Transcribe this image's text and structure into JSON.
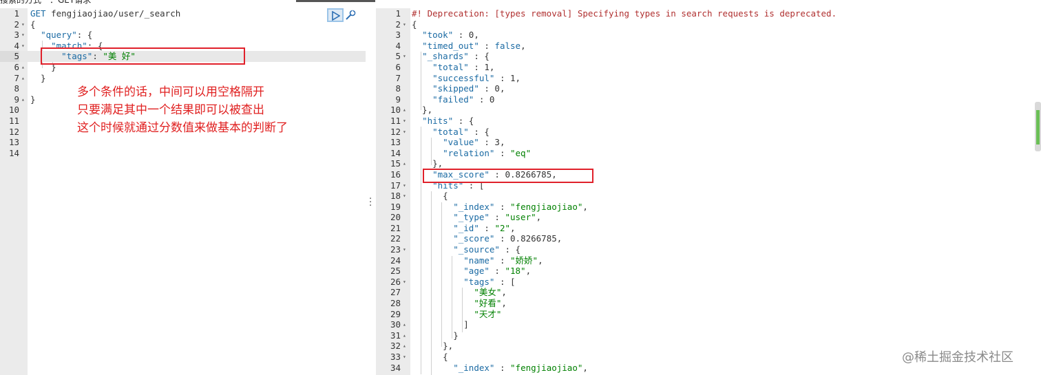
{
  "top_strip_text": "搜索的方式一：GET请求",
  "request_pane": {
    "lines": [
      {
        "n": "1",
        "fold": "",
        "html": [
          [
            "k",
            "GET "
          ],
          [
            "p",
            "fengjiaojiao/user/_search"
          ]
        ]
      },
      {
        "n": "2",
        "fold": "▾",
        "html": [
          [
            "p",
            "{"
          ]
        ]
      },
      {
        "n": "3",
        "fold": "▾",
        "html": [
          [
            "p",
            "  "
          ],
          [
            "n",
            "\"query\""
          ],
          [
            "p",
            ": {"
          ]
        ]
      },
      {
        "n": "4",
        "fold": "▾",
        "html": [
          [
            "p",
            "    "
          ],
          [
            "n",
            "\"match\""
          ],
          [
            "p",
            ": {"
          ]
        ]
      },
      {
        "n": "5",
        "fold": "",
        "html": [
          [
            "p",
            "      "
          ],
          [
            "n",
            "\"tags\""
          ],
          [
            "p",
            ": "
          ],
          [
            "s",
            "\"美 好\""
          ]
        ],
        "active": true
      },
      {
        "n": "6",
        "fold": "▴",
        "html": [
          [
            "p",
            "    }"
          ]
        ]
      },
      {
        "n": "7",
        "fold": "▴",
        "html": [
          [
            "p",
            "  }"
          ]
        ]
      },
      {
        "n": "8",
        "fold": "",
        "html": []
      },
      {
        "n": "9",
        "fold": "▴",
        "html": [
          [
            "p",
            "}"
          ]
        ]
      },
      {
        "n": "10",
        "fold": "",
        "html": []
      },
      {
        "n": "11",
        "fold": "",
        "html": []
      },
      {
        "n": "12",
        "fold": "",
        "html": []
      },
      {
        "n": "13",
        "fold": "",
        "html": []
      },
      {
        "n": "14",
        "fold": "",
        "html": []
      }
    ]
  },
  "response_pane": {
    "lines": [
      {
        "n": "1",
        "fold": "",
        "html": [
          [
            "cmt",
            "#! Deprecation: [types removal] Specifying types in search requests is deprecated."
          ]
        ]
      },
      {
        "n": "2",
        "fold": "▾",
        "html": [
          [
            "p",
            "{"
          ]
        ]
      },
      {
        "n": "3",
        "fold": "",
        "html": [
          [
            "p",
            "  "
          ],
          [
            "n",
            "\"took\""
          ],
          [
            "p",
            " : "
          ],
          [
            "m",
            "0"
          ],
          [
            "p",
            ","
          ]
        ]
      },
      {
        "n": "4",
        "fold": "",
        "html": [
          [
            "p",
            "  "
          ],
          [
            "n",
            "\"timed_out\""
          ],
          [
            "p",
            " : "
          ],
          [
            "k",
            "false"
          ],
          [
            "p",
            ","
          ]
        ]
      },
      {
        "n": "5",
        "fold": "▾",
        "html": [
          [
            "p",
            "  "
          ],
          [
            "n",
            "\"_shards\""
          ],
          [
            "p",
            " : {"
          ]
        ]
      },
      {
        "n": "6",
        "fold": "",
        "html": [
          [
            "p",
            "    "
          ],
          [
            "n",
            "\"total\""
          ],
          [
            "p",
            " : "
          ],
          [
            "m",
            "1"
          ],
          [
            "p",
            ","
          ]
        ]
      },
      {
        "n": "7",
        "fold": "",
        "html": [
          [
            "p",
            "    "
          ],
          [
            "n",
            "\"successful\""
          ],
          [
            "p",
            " : "
          ],
          [
            "m",
            "1"
          ],
          [
            "p",
            ","
          ]
        ]
      },
      {
        "n": "8",
        "fold": "",
        "html": [
          [
            "p",
            "    "
          ],
          [
            "n",
            "\"skipped\""
          ],
          [
            "p",
            " : "
          ],
          [
            "m",
            "0"
          ],
          [
            "p",
            ","
          ]
        ]
      },
      {
        "n": "9",
        "fold": "",
        "html": [
          [
            "p",
            "    "
          ],
          [
            "n",
            "\"failed\""
          ],
          [
            "p",
            " : "
          ],
          [
            "m",
            "0"
          ]
        ]
      },
      {
        "n": "10",
        "fold": "▴",
        "html": [
          [
            "p",
            "  },"
          ]
        ]
      },
      {
        "n": "11",
        "fold": "▾",
        "html": [
          [
            "p",
            "  "
          ],
          [
            "n",
            "\"hits\""
          ],
          [
            "p",
            " : {"
          ]
        ]
      },
      {
        "n": "12",
        "fold": "▾",
        "html": [
          [
            "p",
            "    "
          ],
          [
            "n",
            "\"total\""
          ],
          [
            "p",
            " : {"
          ]
        ]
      },
      {
        "n": "13",
        "fold": "",
        "html": [
          [
            "p",
            "      "
          ],
          [
            "n",
            "\"value\""
          ],
          [
            "p",
            " : "
          ],
          [
            "m",
            "3"
          ],
          [
            "p",
            ","
          ]
        ]
      },
      {
        "n": "14",
        "fold": "",
        "html": [
          [
            "p",
            "      "
          ],
          [
            "n",
            "\"relation\""
          ],
          [
            "p",
            " : "
          ],
          [
            "s",
            "\"eq\""
          ]
        ]
      },
      {
        "n": "15",
        "fold": "▴",
        "html": [
          [
            "p",
            "    },"
          ]
        ]
      },
      {
        "n": "16",
        "fold": "",
        "html": [
          [
            "p",
            "    "
          ],
          [
            "n",
            "\"max_score\""
          ],
          [
            "p",
            " : "
          ],
          [
            "m",
            "0.8266785"
          ],
          [
            "p",
            ","
          ]
        ]
      },
      {
        "n": "17",
        "fold": "▾",
        "html": [
          [
            "p",
            "    "
          ],
          [
            "n",
            "\"hits\""
          ],
          [
            "p",
            " : ["
          ]
        ]
      },
      {
        "n": "18",
        "fold": "▾",
        "html": [
          [
            "p",
            "      {"
          ]
        ]
      },
      {
        "n": "19",
        "fold": "",
        "html": [
          [
            "p",
            "        "
          ],
          [
            "n",
            "\"_index\""
          ],
          [
            "p",
            " : "
          ],
          [
            "s",
            "\"fengjiaojiao\""
          ],
          [
            "p",
            ","
          ]
        ]
      },
      {
        "n": "20",
        "fold": "",
        "html": [
          [
            "p",
            "        "
          ],
          [
            "n",
            "\"_type\""
          ],
          [
            "p",
            " : "
          ],
          [
            "s",
            "\"user\""
          ],
          [
            "p",
            ","
          ]
        ]
      },
      {
        "n": "21",
        "fold": "",
        "html": [
          [
            "p",
            "        "
          ],
          [
            "n",
            "\"_id\""
          ],
          [
            "p",
            " : "
          ],
          [
            "s",
            "\"2\""
          ],
          [
            "p",
            ","
          ]
        ]
      },
      {
        "n": "22",
        "fold": "",
        "html": [
          [
            "p",
            "        "
          ],
          [
            "n",
            "\"_score\""
          ],
          [
            "p",
            " : "
          ],
          [
            "m",
            "0.8266785"
          ],
          [
            "p",
            ","
          ]
        ]
      },
      {
        "n": "23",
        "fold": "▾",
        "html": [
          [
            "p",
            "        "
          ],
          [
            "n",
            "\"_source\""
          ],
          [
            "p",
            " : {"
          ]
        ]
      },
      {
        "n": "24",
        "fold": "",
        "html": [
          [
            "p",
            "          "
          ],
          [
            "n",
            "\"name\""
          ],
          [
            "p",
            " : "
          ],
          [
            "s",
            "\"娇娇\""
          ],
          [
            "p",
            ","
          ]
        ]
      },
      {
        "n": "25",
        "fold": "",
        "html": [
          [
            "p",
            "          "
          ],
          [
            "n",
            "\"age\""
          ],
          [
            "p",
            " : "
          ],
          [
            "s",
            "\"18\""
          ],
          [
            "p",
            ","
          ]
        ]
      },
      {
        "n": "26",
        "fold": "▾",
        "html": [
          [
            "p",
            "          "
          ],
          [
            "n",
            "\"tags\""
          ],
          [
            "p",
            " : ["
          ]
        ]
      },
      {
        "n": "27",
        "fold": "",
        "html": [
          [
            "p",
            "            "
          ],
          [
            "s",
            "\"美女\""
          ],
          [
            "p",
            ","
          ]
        ]
      },
      {
        "n": "28",
        "fold": "",
        "html": [
          [
            "p",
            "            "
          ],
          [
            "s",
            "\"好看\""
          ],
          [
            "p",
            ","
          ]
        ]
      },
      {
        "n": "29",
        "fold": "",
        "html": [
          [
            "p",
            "            "
          ],
          [
            "s",
            "\"天才\""
          ]
        ]
      },
      {
        "n": "30",
        "fold": "▴",
        "html": [
          [
            "p",
            "          ]"
          ]
        ]
      },
      {
        "n": "31",
        "fold": "▴",
        "html": [
          [
            "p",
            "        }"
          ]
        ]
      },
      {
        "n": "32",
        "fold": "▴",
        "html": [
          [
            "p",
            "      },"
          ]
        ]
      },
      {
        "n": "33",
        "fold": "▾",
        "html": [
          [
            "p",
            "      {"
          ]
        ]
      },
      {
        "n": "34",
        "fold": "",
        "html": [
          [
            "p",
            "        "
          ],
          [
            "n",
            "\"_index\""
          ],
          [
            "p",
            " : "
          ],
          [
            "s",
            "\"fengjiaojiao\""
          ],
          [
            "p",
            ","
          ]
        ]
      }
    ]
  },
  "annotation": {
    "line1": "多个条件的话，中间可以用空格隔开",
    "line2": "只要满足其中一个结果即可以被查出",
    "line3": "这个时候就通过分数值来做基本的判断了"
  },
  "watermark": "@稀土掘金技术社区",
  "colors": {
    "annotation_red": "#e0202a",
    "key_blue": "#1a6aa3",
    "string_green": "#008000",
    "deprecation_red": "#b03030"
  },
  "icons": {
    "run": "play-icon",
    "settings": "wrench-icon"
  }
}
